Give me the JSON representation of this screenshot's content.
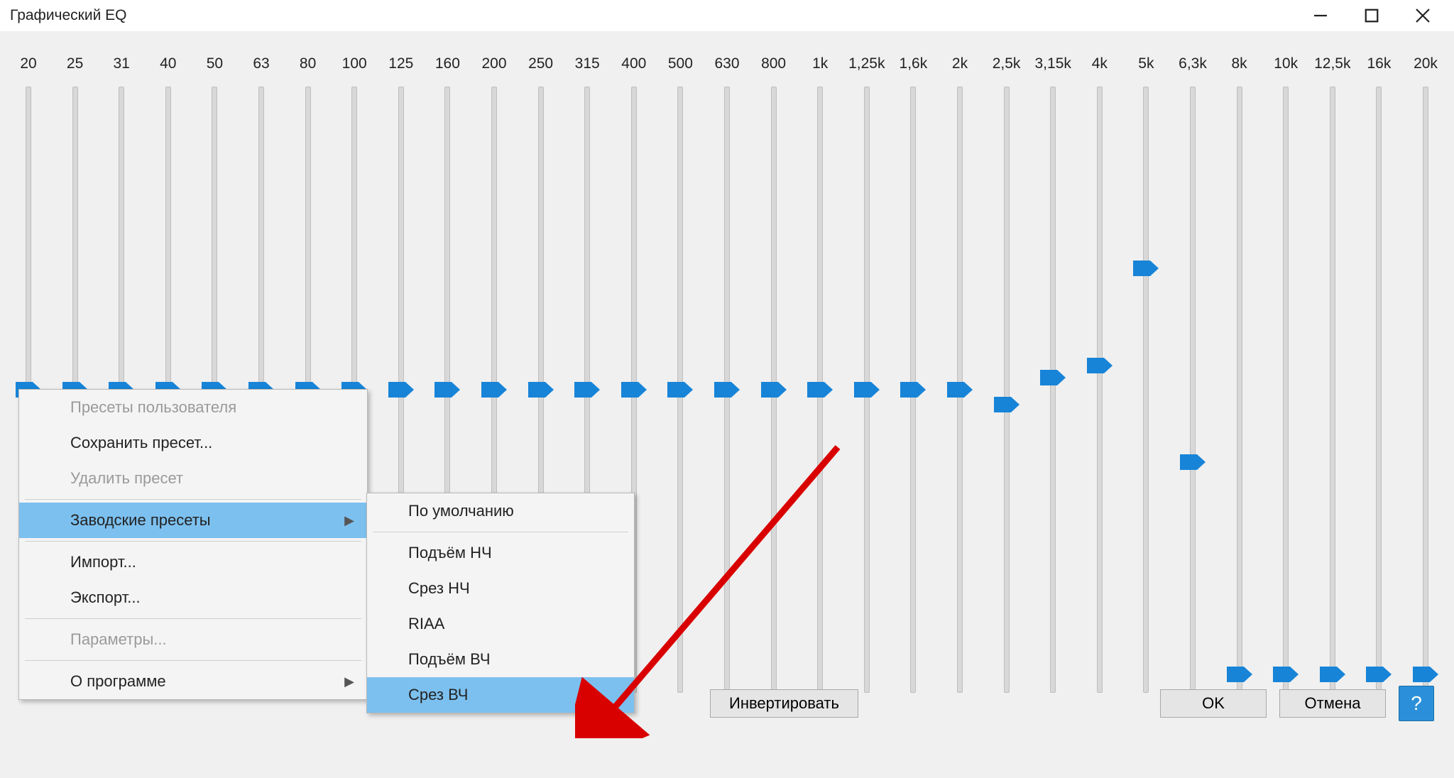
{
  "window": {
    "title": "Графический EQ"
  },
  "eq": {
    "frequencies": [
      "20",
      "25",
      "31",
      "40",
      "50",
      "63",
      "80",
      "100",
      "125",
      "160",
      "200",
      "250",
      "315",
      "400",
      "500",
      "630",
      "800",
      "1k",
      "1,25k",
      "1,6k",
      "2k",
      "2,5k",
      "3,15k",
      "4k",
      "5k",
      "6,3k",
      "8k",
      "10k",
      "12,5k",
      "16k",
      "20k"
    ],
    "positions_percent": [
      50,
      50,
      50,
      50,
      50,
      50,
      50,
      50,
      50,
      50,
      50,
      50,
      50,
      50,
      50,
      50,
      50,
      50,
      50,
      50,
      50,
      52.5,
      48,
      46,
      30,
      62,
      97,
      97,
      97,
      97,
      97
    ]
  },
  "menu": {
    "user_presets": "Пресеты пользователя",
    "save_preset": "Сохранить пресет...",
    "delete_preset": "Удалить пресет",
    "factory_presets": "Заводские пресеты",
    "import": "Импорт...",
    "export": "Экспорт...",
    "options": "Параметры...",
    "about": "О программе"
  },
  "submenu": {
    "default": "По умолчанию",
    "bass_boost": "Подъём НЧ",
    "bass_cut": "Срез НЧ",
    "riaa": "RIAA",
    "treble_boost": "Подъём ВЧ",
    "treble_cut": "Срез ВЧ"
  },
  "buttons": {
    "invert": "Инвертировать",
    "ok": "OK",
    "cancel": "Отмена"
  }
}
